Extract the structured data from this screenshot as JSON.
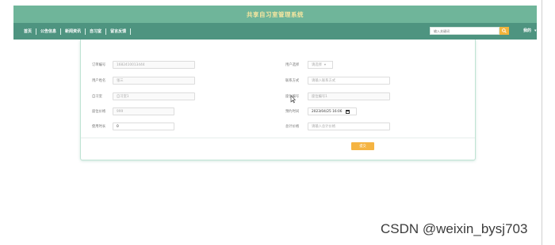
{
  "app": {
    "title": "共享自习室管理系统"
  },
  "nav": {
    "items": [
      "首页",
      "公告信息",
      "新闻资讯",
      "自习室",
      "留言反馈"
    ],
    "search_placeholder": "输入关键词",
    "user_label": "我的",
    "user_caret": "▾"
  },
  "form": {
    "fields": [
      {
        "label": "订单编号",
        "value": "1682410013444"
      },
      {
        "label": "用户姓名",
        "value": "张三"
      },
      {
        "label": "自习室",
        "value": "自习室1"
      },
      {
        "label": "座位价格",
        "value": "999"
      },
      {
        "label": "使用时长",
        "value": "0"
      }
    ],
    "right_fields": [
      {
        "label": "用户选择",
        "value": "请选择",
        "caret": "▾"
      },
      {
        "label": "联系方式",
        "value": "请输入联系方式"
      },
      {
        "label": "座位编号",
        "value": "座位编号1"
      },
      {
        "label": "预约时间",
        "value": "2023/04/25 16:06"
      },
      {
        "label": "总计价格",
        "value": "请输入总计价格"
      }
    ],
    "submit_label": "提交"
  },
  "colors": {
    "header": "#6fb59a",
    "nav": "#4e9480",
    "accent": "#f5b442"
  },
  "watermark": "CSDN @weixin_bysj703"
}
